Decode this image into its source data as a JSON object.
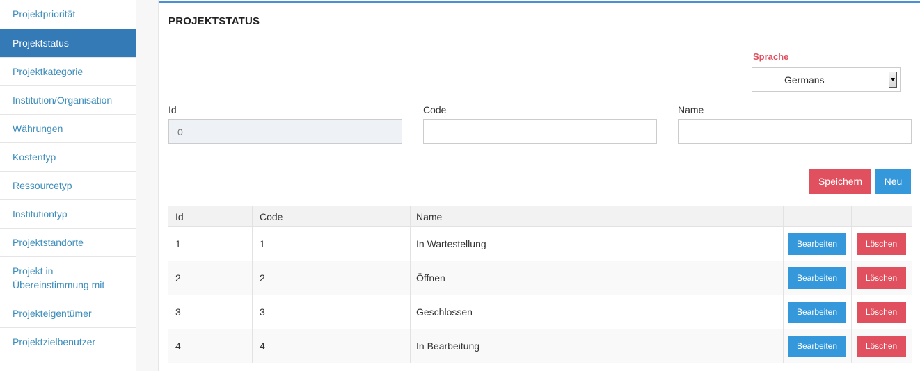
{
  "sidebar": {
    "items": [
      {
        "label": "Projektpriorität"
      },
      {
        "label": "Projektstatus"
      },
      {
        "label": "Projektkategorie"
      },
      {
        "label": "Institution/Organisation"
      },
      {
        "label": "Währungen"
      },
      {
        "label": "Kostentyp"
      },
      {
        "label": "Ressourcetyp"
      },
      {
        "label": "Institutiontyp"
      },
      {
        "label": "Projektstandorte"
      },
      {
        "label_line1": "Projekt in",
        "label_line2": "Übereinstimmung mit"
      },
      {
        "label": "Projekteigentümer"
      },
      {
        "label": "Projektzielbenutzer"
      }
    ],
    "active_index": 1
  },
  "page": {
    "title": "PROJEKTSTATUS"
  },
  "language": {
    "label": "Sprache",
    "selected": "Germans"
  },
  "form": {
    "id_label": "Id",
    "id_value": "0",
    "code_label": "Code",
    "code_value": "",
    "name_label": "Name",
    "name_value": ""
  },
  "actions": {
    "save_label": "Speichern",
    "new_label": "Neu"
  },
  "table": {
    "headers": [
      "Id",
      "Code",
      "Name",
      "",
      ""
    ],
    "rows": [
      {
        "id": "1",
        "code": "1",
        "name": "In Wartestellung",
        "edit": "Bearbeiten",
        "delete": "Löschen"
      },
      {
        "id": "2",
        "code": "2",
        "name": "Öffnen",
        "edit": "Bearbeiten",
        "delete": "Löschen"
      },
      {
        "id": "3",
        "code": "3",
        "name": "Geschlossen",
        "edit": "Bearbeiten",
        "delete": "Löschen"
      },
      {
        "id": "4",
        "code": "4",
        "name": "In Bearbeitung",
        "edit": "Bearbeiten",
        "delete": "Löschen"
      }
    ]
  },
  "colors": {
    "accent_blue": "#337ab7",
    "link_blue": "#3c8dbc",
    "button_blue": "#3498db",
    "button_red": "#e0505e"
  }
}
